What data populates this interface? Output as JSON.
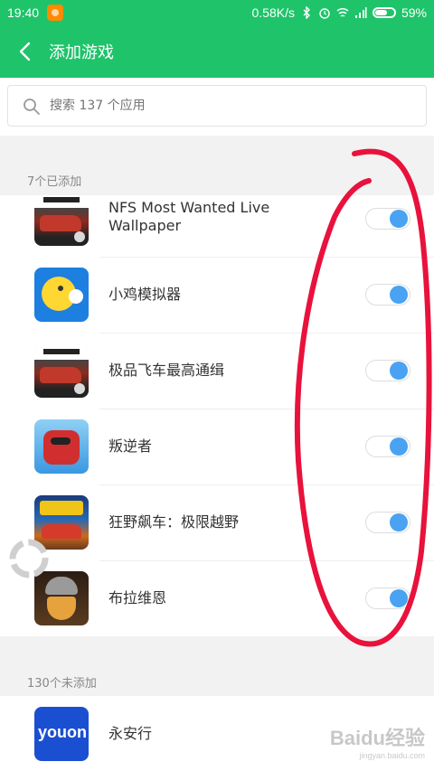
{
  "status_bar": {
    "time": "19:40",
    "network_speed": "0.58K/s",
    "battery": "59%"
  },
  "header": {
    "title": "添加游戏"
  },
  "search": {
    "placeholder": "搜索 137 个应用"
  },
  "added_section": {
    "label": "7个已添加",
    "items": [
      {
        "name": "NFS Most Wanted Live Wallpaper",
        "icon": "nfs-icon",
        "enabled": true
      },
      {
        "name": "小鸡模拟器",
        "icon": "chick-emulator-icon",
        "enabled": true
      },
      {
        "name": "极品飞车最高通缉",
        "icon": "nfs-icon",
        "enabled": true
      },
      {
        "name": "叛逆者",
        "icon": "rebel-icon",
        "enabled": true
      },
      {
        "name": "狂野飙车：极限越野",
        "icon": "asphalt-xtreme-icon",
        "enabled": true
      },
      {
        "name": "布拉维恩",
        "icon": "viking-icon",
        "enabled": true
      }
    ]
  },
  "not_added_section": {
    "label": "130个未添加",
    "items": [
      {
        "name": "永安行",
        "icon": "youon-icon",
        "icon_text": "youon"
      }
    ]
  },
  "watermark": {
    "text": "Baidu经验",
    "sub": "jingyan.baidu.com"
  },
  "colors": {
    "accent": "#1fc36a",
    "toggle_on": "#4aa2f2",
    "annotation": "#e8123c"
  }
}
